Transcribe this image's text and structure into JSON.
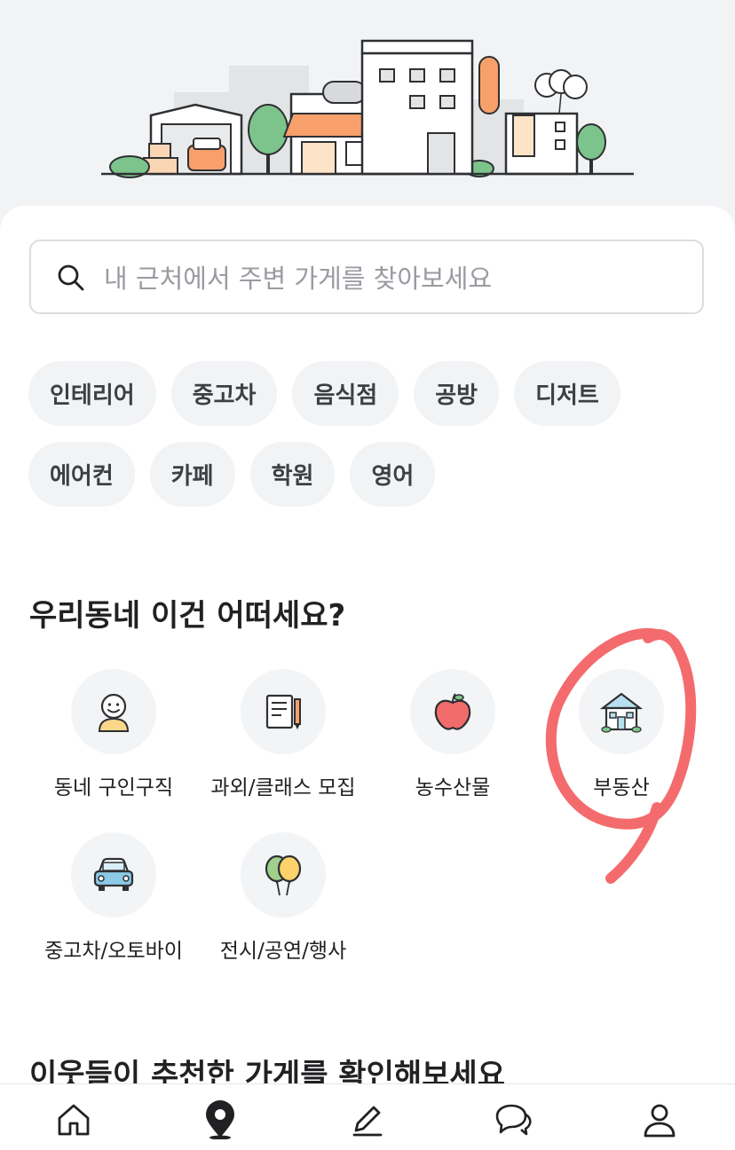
{
  "search": {
    "placeholder": "내 근처에서 주변 가게를 찾아보세요"
  },
  "chips": {
    "row1": [
      "인테리어",
      "중고차",
      "음식점",
      "공방",
      "디저트"
    ],
    "row2": [
      "에어컨",
      "카페",
      "학원",
      "영어"
    ]
  },
  "section1": {
    "title": "우리동네 이건 어떠세요?",
    "categories": [
      {
        "label": "동네 구인구직",
        "icon": "person-icon"
      },
      {
        "label": "과외/클래스 모집",
        "icon": "notebook-pencil-icon"
      },
      {
        "label": "농수산물",
        "icon": "apple-icon"
      },
      {
        "label": "부동산",
        "icon": "house-icon"
      },
      {
        "label": "중고차/오토바이",
        "icon": "car-icon"
      },
      {
        "label": "전시/공연/행사",
        "icon": "balloons-icon"
      }
    ]
  },
  "section2": {
    "title": "이웃들이 추천한 가게를 확인해보세요"
  },
  "bottom_nav": [
    "home-icon",
    "location-pin-icon",
    "pencil-icon",
    "chat-icon",
    "profile-icon"
  ],
  "colors": {
    "accent_orange": "#ff8a3d",
    "annotation_red": "#f46b6e",
    "chip_bg": "#f2f3f5"
  }
}
